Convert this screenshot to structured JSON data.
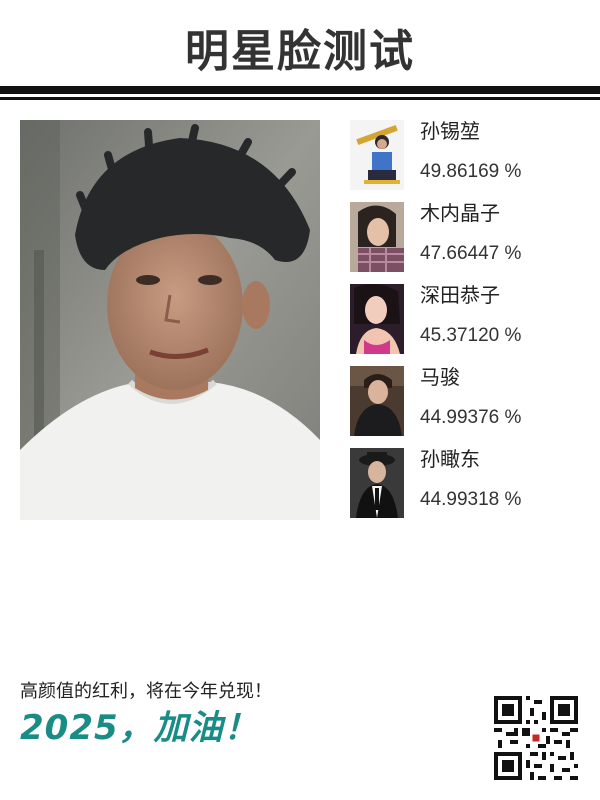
{
  "header": {
    "title": "明星脸测试"
  },
  "results": [
    {
      "name": "孙锡堃",
      "score": "49.86169 %",
      "thumb": "boy-with-skateboard-portrait"
    },
    {
      "name": "木内晶子",
      "score": "47.66447 %",
      "thumb": "woman-plaid-shirt-portrait"
    },
    {
      "name": "深田恭子",
      "score": "45.37120 %",
      "thumb": "woman-pink-top-portrait"
    },
    {
      "name": "马骏",
      "score": "44.99376 %",
      "thumb": "man-dark-sweater-portrait"
    },
    {
      "name": "孙瞰东",
      "score": "44.99318 %",
      "thumb": "man-with-hat-portrait"
    }
  ],
  "footer": {
    "slogan": "高颜值的红利，将在今年兑现！",
    "cheer": "2025，加油！"
  },
  "colors": {
    "accent": "#1a8c86",
    "rule": "#111111"
  }
}
